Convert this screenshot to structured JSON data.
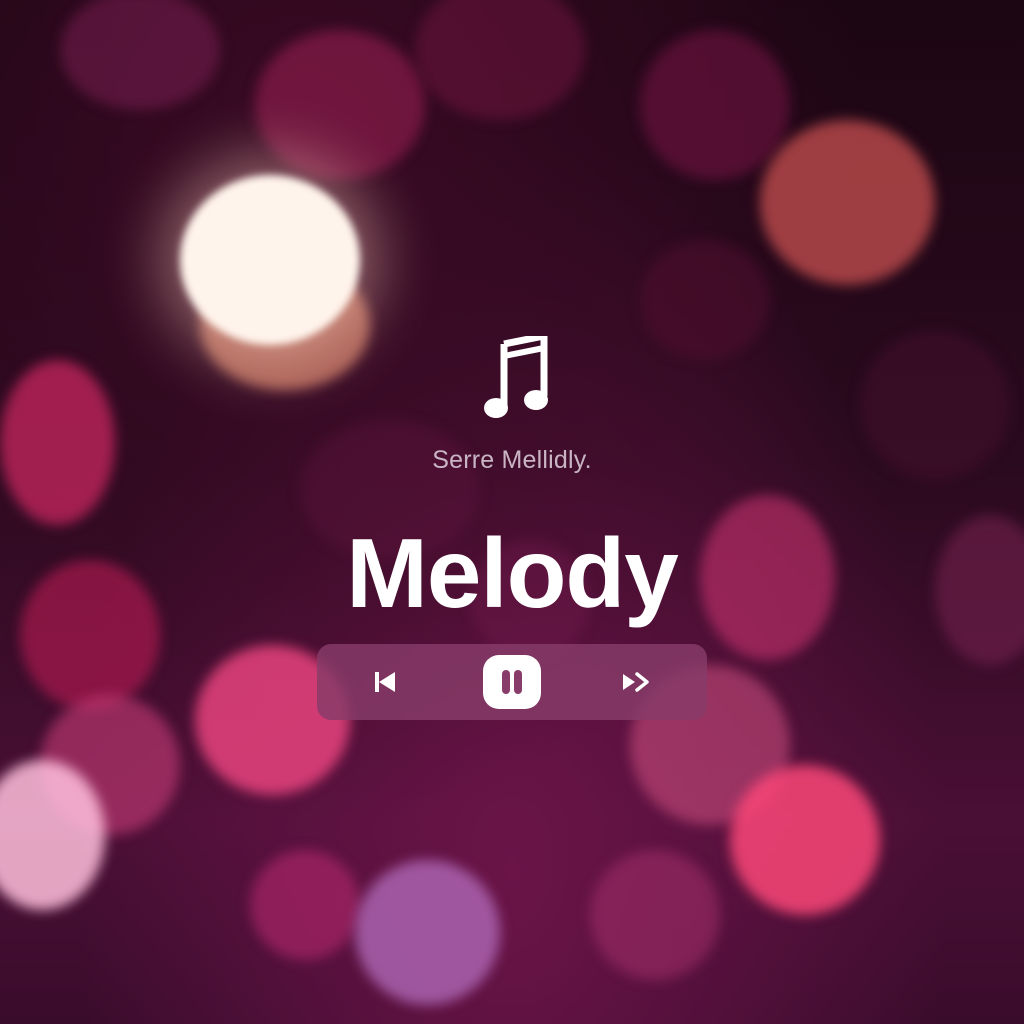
{
  "background": {
    "base_color": "#1a0612",
    "accent_pink": "#e94684",
    "highlight": "#fff4ec"
  },
  "player": {
    "app_icon": "music-note-icon",
    "subtitle": "Serre Mellidly.",
    "title": "Melody",
    "controls": {
      "previous": {
        "icon": "skip-previous-icon"
      },
      "pause": {
        "icon": "pause-icon",
        "state": "playing"
      },
      "next": {
        "icon": "skip-next-icon"
      }
    },
    "bar_color": "#873c69"
  }
}
